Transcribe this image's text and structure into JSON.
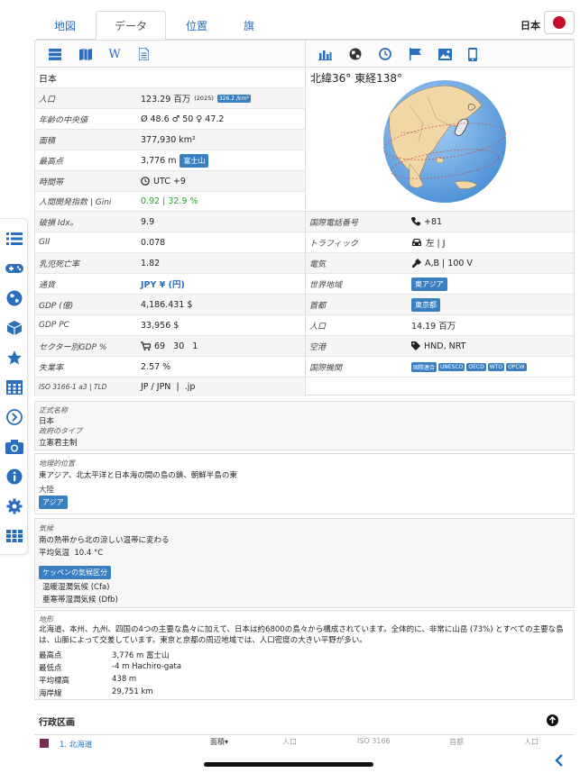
{
  "tabs": [
    "地図",
    "データ",
    "位置",
    "旗"
  ],
  "active_tab": "データ",
  "country": "日本",
  "coords": "北緯36° 東経138°",
  "left_table": [
    {
      "label": "日本",
      "value": "",
      "shade": false
    },
    {
      "label": "人口",
      "value": "123.29 百万",
      "extra": "(2025)",
      "badge": "326.2 /km²",
      "shade": true
    },
    {
      "label": "年齢の中央値",
      "value": "Ø 48.6  ♂ 50  ♀ 47.2",
      "shade": false
    },
    {
      "label": "面積",
      "value": "377,930 km²",
      "shade": true
    },
    {
      "label": "最高点",
      "value": "3,776 m",
      "badge": "富士山",
      "shade": false
    },
    {
      "label": "時間帯",
      "value": "UTC +9",
      "shade": true
    },
    {
      "label": "人間開発指数 | Gini",
      "value": "0.92 | 32.9 %",
      "shade": false
    }
  ],
  "left_rows": [
    {
      "label": "破損 Idx。",
      "value": "9.9"
    },
    {
      "label": "GII",
      "value": "0.078"
    },
    {
      "label": "乳児死亡率",
      "value": "1.82"
    },
    {
      "label": "通貨",
      "value": "JPY ¥ (円)"
    },
    {
      "label": "GDP (億)",
      "value": "4,186.431 $"
    },
    {
      "label": "GDP PC",
      "value": "33,956 $"
    },
    {
      "label": "セクター別GDP %",
      "value": "69   30   1"
    },
    {
      "label": "失業率",
      "value": "2.57 %"
    },
    {
      "label": "ISO 3166-1 a3 | TLD",
      "value": "JP / JPN  |  .jp"
    }
  ],
  "right_rows": [
    {
      "label": "国際電話番号",
      "value": "+81"
    },
    {
      "label": "トラフィック",
      "value": "左 | J"
    },
    {
      "label": "電気",
      "value": "A,B | 100 V"
    },
    {
      "label": "世界地域",
      "badge": "東アジア"
    },
    {
      "label": "首都",
      "badge": "東京都"
    },
    {
      "label": "人口",
      "value": "14.19 百万"
    },
    {
      "label": "空港",
      "value": "HND, NRT"
    },
    {
      "label": "国際機関",
      "badges": [
        "国際連合",
        "UNESCO",
        "OECD",
        "WTO",
        "OPCW"
      ]
    }
  ],
  "official": {
    "title": "正式名称",
    "value": "日本",
    "gov_title": "政府のタイプ",
    "gov_value": "立憲君主制"
  },
  "geo": {
    "title": "地理的位置",
    "value": "東アジア、北太平洋と日本海の間の島の鎖、朝鮮半島の東",
    "continent_label": "大陸",
    "continent": "アジア"
  },
  "climate": {
    "title": "気候",
    "value": "南の熱帯から北の涼しい温帯に変わる",
    "avg_temp": "平均気温  10.4 °C",
    "koppen": "ケッペンの気候区分",
    "k1": "温暖湿潤気候 (Cfa)",
    "k2": "亜寒帯湿潤気候 (Dfb)"
  },
  "terrain": {
    "title": "地形",
    "text": "北海道、本州、九州、四国の4つの主要な島々に加えて、日本は約6800の島々から構成されています。全体的に、非常に山岳 (73%) とすべての主要な島は、山脈によって交差しています。東京と京都の周辺地域では、人口密度の大きい平野が多い。",
    "rows": [
      {
        "k": "最高点",
        "v": "3,776 m 富士山"
      },
      {
        "k": "最低点",
        "v": "-4 m Hachiro-gata"
      },
      {
        "k": "平均標高",
        "v": "438 m"
      },
      {
        "k": "海岸線",
        "v": "29,751 km"
      }
    ]
  },
  "admin": {
    "title": "行政区画",
    "first": "1. 北海道",
    "cols": [
      "面積▾",
      "人口",
      "ISO 3166",
      "首都",
      "人口"
    ]
  }
}
